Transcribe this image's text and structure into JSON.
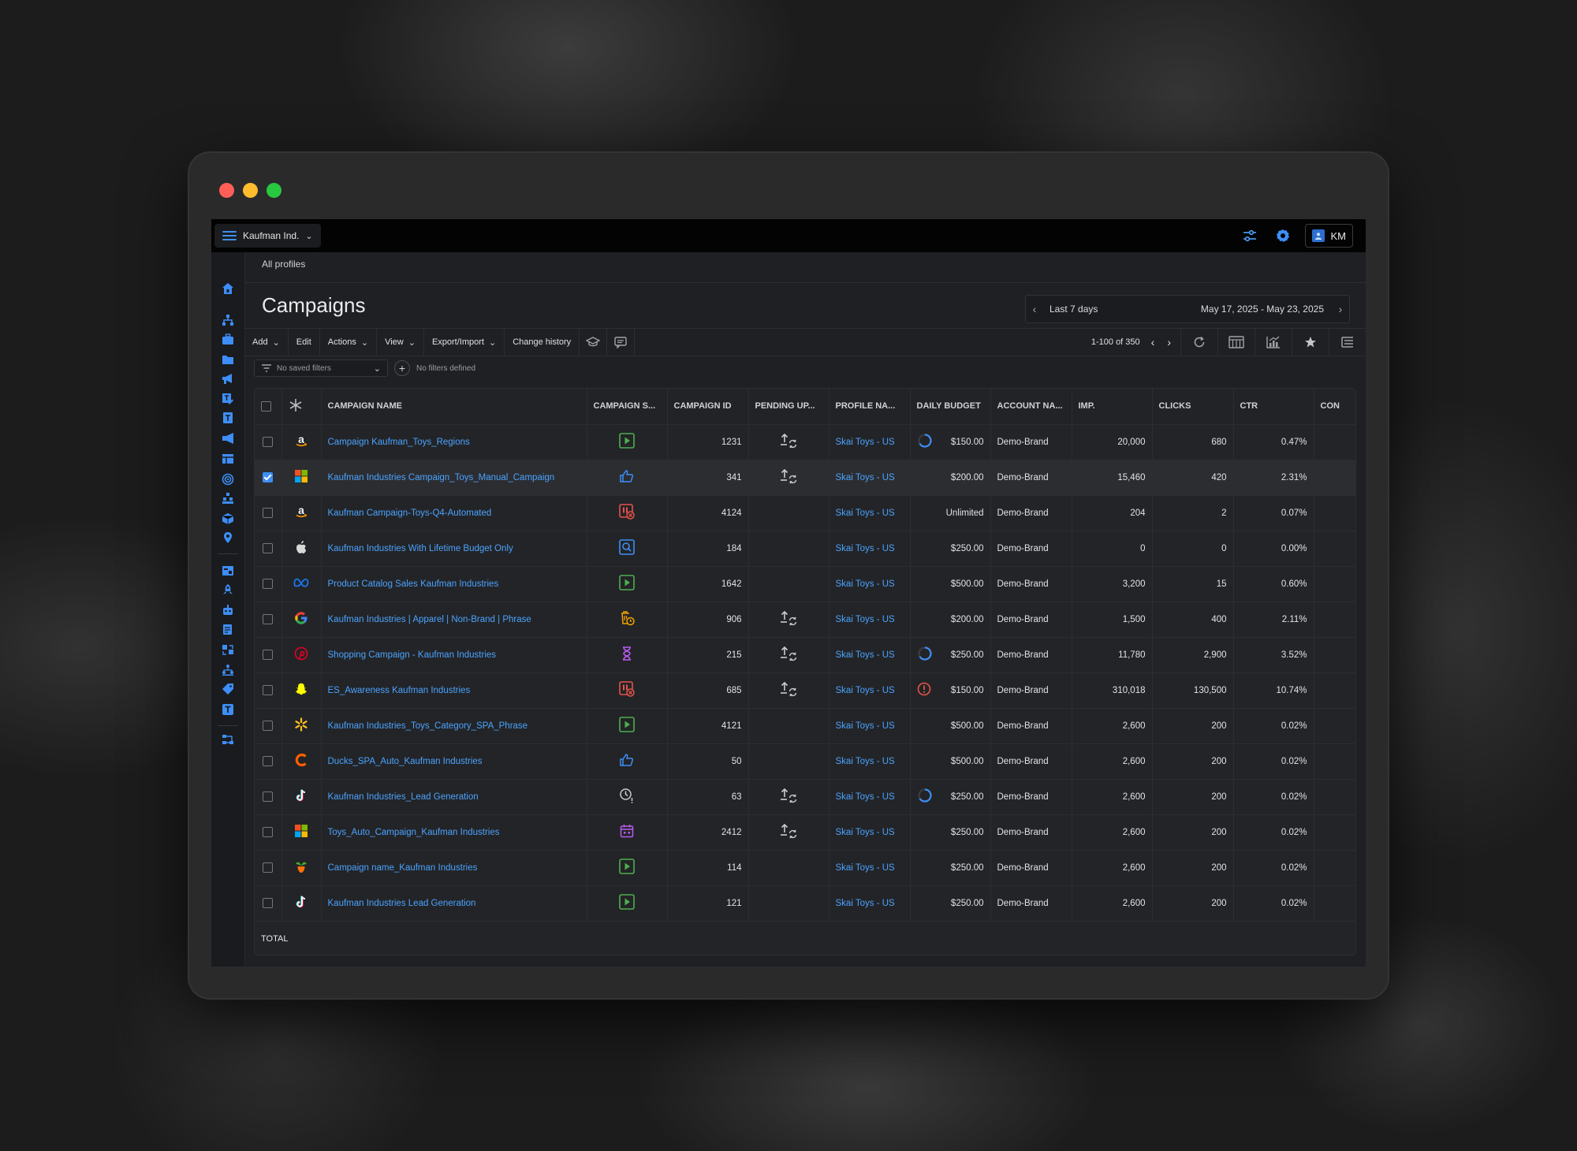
{
  "app": {
    "account_name": "Kaufman Ind.",
    "user_initials": "KM",
    "breadcrumb": "All profiles",
    "page_title": "Campaigns"
  },
  "date_range": {
    "label": "Last 7 days",
    "value": "May 17, 2025 - May 23, 2025"
  },
  "toolbar": {
    "add": "Add",
    "edit": "Edit",
    "actions": "Actions",
    "view": "View",
    "export_import": "Export/Import",
    "change_history": "Change history",
    "pager": "1-100 of 350"
  },
  "filters": {
    "saved_placeholder": "No saved filters",
    "none_defined": "No filters defined"
  },
  "columns": [
    "CAMPAIGN NAME",
    "CAMPAIGN S...",
    "CAMPAIGN ID",
    "PENDING UP...",
    "PROFILE NA...",
    "DAILY BUDGET",
    "ACCOUNT NA...",
    "IMP.",
    "CLICKS",
    "CTR",
    "CON"
  ],
  "rows": [
    {
      "channel": "amazon-icon",
      "name": "Campaign Kaufman_Toys_Regions",
      "status": "play-icon",
      "id": "1231",
      "pending": true,
      "profile": "Skai Toys - US",
      "budget_icon": "progress-ring-icon",
      "budget": "$150.00",
      "account": "Demo-Brand",
      "imp": "20,000",
      "clicks": "680",
      "ctr": "0.47%",
      "checked": false
    },
    {
      "channel": "microsoft-icon",
      "name": "Kaufman Industries Campaign_Toys_Manual_Campaign",
      "status": "thumb-icon",
      "id": "341",
      "pending": true,
      "profile": "Skai Toys - US",
      "budget_icon": "",
      "budget": "$200.00",
      "account": "Demo-Brand",
      "imp": "15,460",
      "clicks": "420",
      "ctr": "2.31%",
      "checked": true
    },
    {
      "channel": "amazon-icon",
      "name": "Kaufman Campaign-Toys-Q4-Automated",
      "status": "paused-alert-icon",
      "id": "4124",
      "pending": false,
      "profile": "Skai Toys - US",
      "budget_icon": "",
      "budget": "Unlimited",
      "account": "Demo-Brand",
      "imp": "204",
      "clicks": "2",
      "ctr": "0.07%",
      "checked": false
    },
    {
      "channel": "apple-icon",
      "name": "Kaufman Industries With Lifetime Budget Only",
      "status": "search-review-icon",
      "id": "184",
      "pending": false,
      "profile": "Skai Toys - US",
      "budget_icon": "",
      "budget": "$250.00",
      "account": "Demo-Brand",
      "imp": "0",
      "clicks": "0",
      "ctr": "0.00%",
      "checked": false
    },
    {
      "channel": "meta-icon",
      "name": "Product Catalog Sales Kaufman Industries",
      "status": "play-icon",
      "id": "1642",
      "pending": false,
      "profile": "Skai Toys - US",
      "budget_icon": "",
      "budget": "$500.00",
      "account": "Demo-Brand",
      "imp": "3,200",
      "clicks": "15",
      "ctr": "0.60%",
      "checked": false
    },
    {
      "channel": "google-icon",
      "name": "Kaufman Industries | Apparel | Non-Brand | Phrase",
      "status": "trash-clock-icon",
      "id": "906",
      "pending": true,
      "profile": "Skai Toys - US",
      "budget_icon": "",
      "budget": "$200.00",
      "account": "Demo-Brand",
      "imp": "1,500",
      "clicks": "400",
      "ctr": "2.11%",
      "checked": false
    },
    {
      "channel": "pinterest-icon",
      "name": "Shopping Campaign - Kaufman Industries",
      "status": "hourglass-icon",
      "id": "215",
      "pending": true,
      "profile": "Skai Toys - US",
      "budget_icon": "progress-ring-icon",
      "budget": "$250.00",
      "account": "Demo-Brand",
      "imp": "11,780",
      "clicks": "2,900",
      "ctr": "3.52%",
      "checked": false
    },
    {
      "channel": "snapchat-icon",
      "name": "ES_Awareness Kaufman Industries",
      "status": "paused-alert-icon",
      "id": "685",
      "pending": true,
      "profile": "Skai Toys - US",
      "budget_icon": "alert-circle-icon",
      "budget": "$150.00",
      "account": "Demo-Brand",
      "imp": "310,018",
      "clicks": "130,500",
      "ctr": "10.74%",
      "checked": false
    },
    {
      "channel": "walmart-icon",
      "name": "Kaufman Industries_Toys_Category_SPA_Phrase",
      "status": "play-icon",
      "id": "4121",
      "pending": false,
      "profile": "Skai Toys - US",
      "budget_icon": "",
      "budget": "$500.00",
      "account": "Demo-Brand",
      "imp": "2,600",
      "clicks": "200",
      "ctr": "0.02%",
      "checked": false
    },
    {
      "channel": "criteo-icon",
      "name": "Ducks_SPA_Auto_Kaufman Industries",
      "status": "thumb-icon",
      "id": "50",
      "pending": false,
      "profile": "Skai Toys - US",
      "budget_icon": "",
      "budget": "$500.00",
      "account": "Demo-Brand",
      "imp": "2,600",
      "clicks": "200",
      "ctr": "0.02%",
      "checked": false
    },
    {
      "channel": "tiktok-icon",
      "name": "Kaufman Industries_Lead Generation",
      "status": "clock-alert-icon",
      "id": "63",
      "pending": true,
      "profile": "Skai Toys - US",
      "budget_icon": "progress-ring-icon",
      "budget": "$250.00",
      "account": "Demo-Brand",
      "imp": "2,600",
      "clicks": "200",
      "ctr": "0.02%",
      "checked": false
    },
    {
      "channel": "microsoft-icon",
      "name": "Toys_Auto_Campaign_Kaufman Industries",
      "status": "calendar-icon",
      "id": "2412",
      "pending": true,
      "profile": "Skai Toys - US",
      "budget_icon": "",
      "budget": "$250.00",
      "account": "Demo-Brand",
      "imp": "2,600",
      "clicks": "200",
      "ctr": "0.02%",
      "checked": false
    },
    {
      "channel": "instacart-icon",
      "name": "Campaign name_Kaufman Industries",
      "status": "play-icon",
      "id": "114",
      "pending": false,
      "profile": "Skai Toys - US",
      "budget_icon": "",
      "budget": "$250.00",
      "account": "Demo-Brand",
      "imp": "2,600",
      "clicks": "200",
      "ctr": "0.02%",
      "checked": false
    },
    {
      "channel": "tiktok-icon",
      "name": "Kaufman Industries Lead Generation",
      "status": "play-icon",
      "id": "121",
      "pending": false,
      "profile": "Skai Toys - US",
      "budget_icon": "",
      "budget": "$250.00",
      "account": "Demo-Brand",
      "imp": "2,600",
      "clicks": "200",
      "ctr": "0.02%",
      "checked": false
    }
  ],
  "total_label": "TOTAL",
  "colors": {
    "accent": "#3d8ef8",
    "link": "#4aa3ff",
    "play_green": "#4caf50",
    "alert_red": "#e5534b"
  }
}
